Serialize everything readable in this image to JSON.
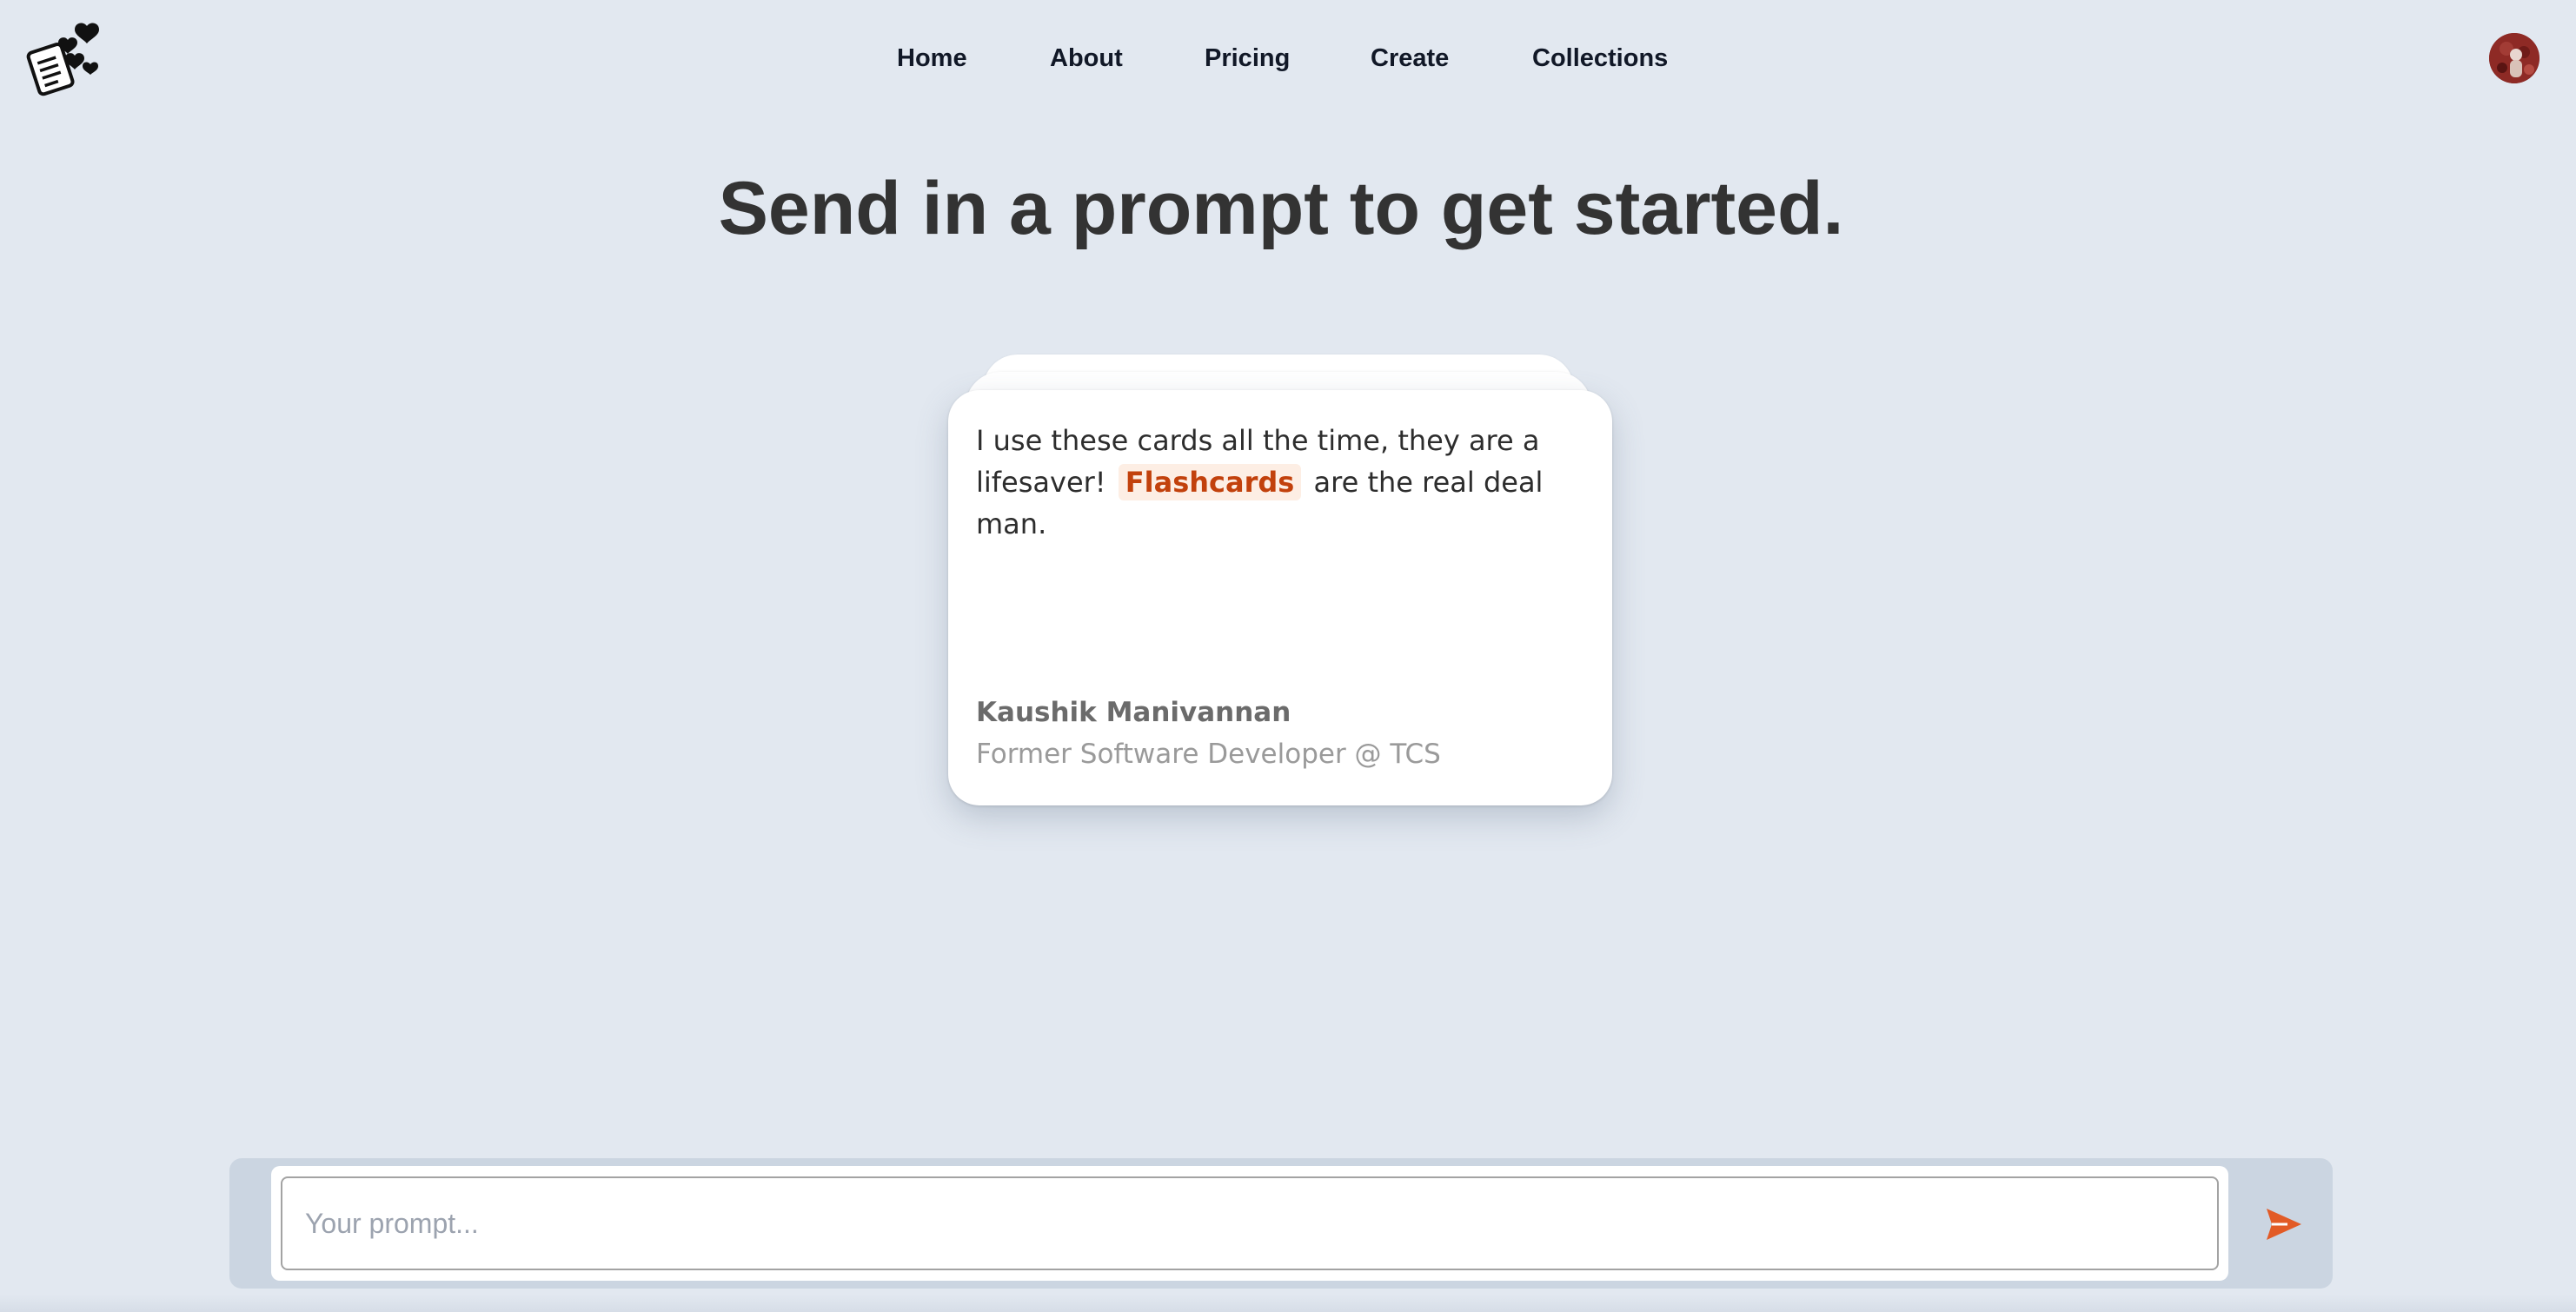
{
  "header": {
    "nav": [
      {
        "label": "Home"
      },
      {
        "label": "About"
      },
      {
        "label": "Pricing"
      },
      {
        "label": "Create"
      },
      {
        "label": "Collections"
      }
    ]
  },
  "main": {
    "title": "Send in a prompt to get started."
  },
  "testimonial": {
    "quote_before": "I use these cards all the time, they are a lifesaver!",
    "quote_highlight": "Flashcards",
    "quote_after": "are the real deal man.",
    "author_name": "Kaushik Manivannan",
    "author_role": "Former Software Developer @ TCS"
  },
  "prompt": {
    "placeholder": "Your prompt...",
    "value": ""
  },
  "icons": {
    "logo": "flashcard-hearts-logo",
    "avatar": "user-avatar",
    "send": "send-icon"
  },
  "colors": {
    "background": "#e2e8f0",
    "accent": "#e25b26",
    "highlight_text": "#c2410c",
    "highlight_bg": "#fdeee4"
  }
}
